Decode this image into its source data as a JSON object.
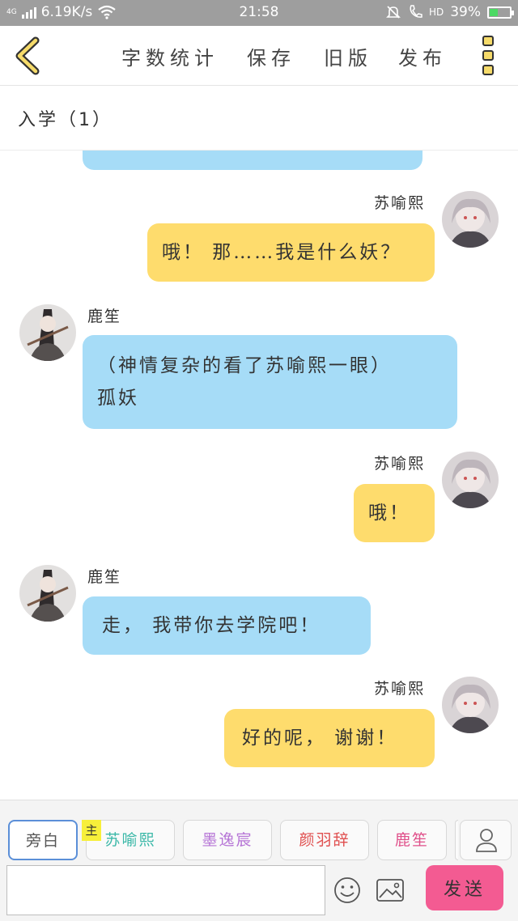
{
  "status_bar": {
    "network": "4G",
    "speed": "6.19K/s",
    "time": "21:58",
    "hd": "HD",
    "battery": "39%",
    "battery_level": 0.39
  },
  "toolbar": {
    "word_count": "字数统计",
    "save": "保存",
    "old_version": "旧版",
    "publish": "发布"
  },
  "chapter": {
    "title": "入学（1）"
  },
  "messages": [
    {
      "speaker": "苏喻熙",
      "text": "哦！ 那……我是什么妖？"
    },
    {
      "speaker": "鹿笙",
      "text_line1": "（神情复杂的看了苏喻熙一眼）",
      "text_line2": "孤妖"
    },
    {
      "speaker": "苏喻熙",
      "text": "哦！"
    },
    {
      "speaker": "鹿笙",
      "text": "走， 我带你去学院吧！"
    },
    {
      "speaker": "苏喻熙",
      "text": "好的呢， 谢谢！"
    }
  ],
  "bottom": {
    "roles": [
      "旁白",
      "苏喻熙",
      "墨逸宸",
      "颜羽辞",
      "鹿笙"
    ],
    "role_colors": [
      "#555555",
      "#3bb8a8",
      "#b675d6",
      "#e05050",
      "#e0508a"
    ],
    "master_tag": "主",
    "input_placeholder": "",
    "send": "发送",
    "send_color": "#f35b92"
  },
  "colors": {
    "left_bubble": "#a6dcf7",
    "right_bubble": "#fedc6d"
  }
}
